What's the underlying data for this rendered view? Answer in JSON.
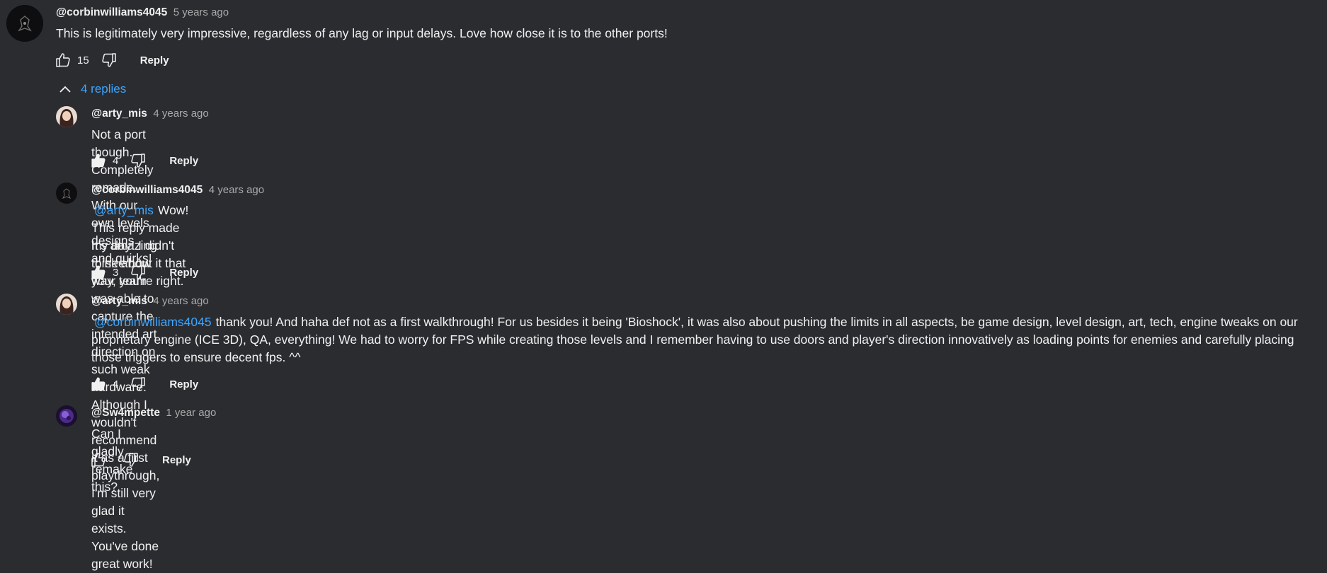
{
  "colors": {
    "background": "#2a2c30",
    "text": "#f1f1f1",
    "muted": "#aaaaaa",
    "link": "#3ea6ff"
  },
  "top_comment": {
    "author": "@corbinwilliams4045",
    "time": "5 years ago",
    "text": "This is legitimately very impressive, regardless of any lag or input delays.  Love how close it is to the other ports!",
    "likes": "15",
    "reply_label": "Reply"
  },
  "replies_toggle": {
    "label": "4 replies",
    "icon": "chevron-up-icon"
  },
  "replies": [
    {
      "author": "@arty_mis",
      "time": "4 years ago",
      "mention": "",
      "text": "Not a port though. Completely remade. With our own levels designs and quirks!",
      "likes": "4",
      "reply_label": "Reply"
    },
    {
      "author": "@corbinwilliams4045",
      "time": "4 years ago",
      "mention": "@arty_mis",
      "text": "Wow! This reply made my day! I didn't think about it that way, you're right.",
      "text2": "It's amazing to see how your team was able to capture the intended art direction on such weak hardware. Although I wouldn't recommend it as a first playthrough, I'm still very glad it exists. You've done great work!",
      "likes": "3",
      "reply_label": "Reply"
    },
    {
      "author": "@arty_mis",
      "time": "4 years ago",
      "mention": "@corbinwilliams4045",
      "text": "thank you! And haha def not as a first walkthrough! For us besides it being 'Bioshock', it was also about pushing the limits in all aspects, be game design, level design, art, tech, engine tweaks on our proprietary engine (ICE 3D), QA, everything! We had to worry for FPS while creating those levels and I remember having to use doors and player's direction innovatively as loading points for enemies and carefully placing those triggers to ensure decent fps. ^^",
      "likes": "4",
      "reply_label": "Reply"
    },
    {
      "author": "@Sw4mpette",
      "time": "1 year ago",
      "mention": "",
      "text": "Can I gladly remake this?",
      "likes": "",
      "reply_label": "Reply"
    }
  ]
}
